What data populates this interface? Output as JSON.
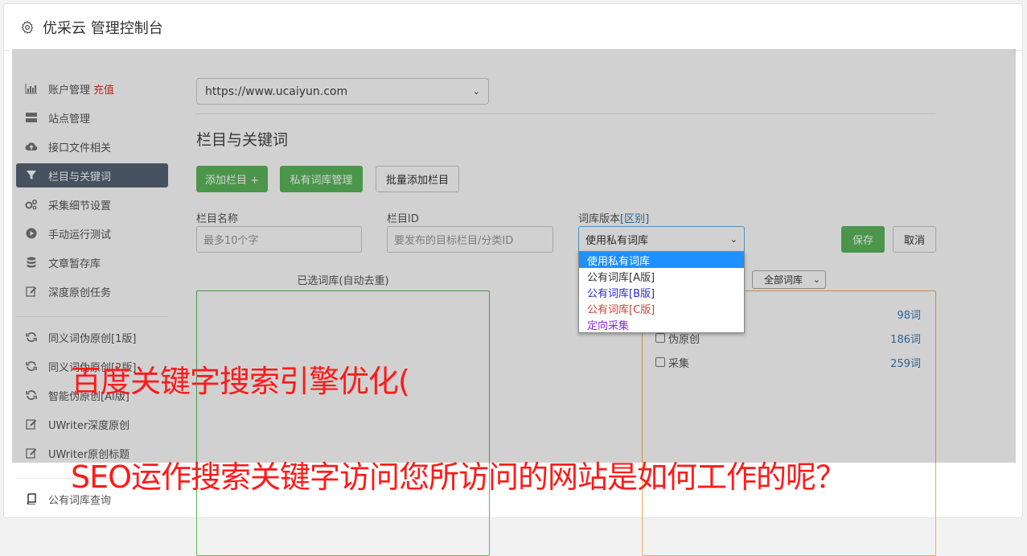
{
  "header": {
    "title": "优采云 管理控制台"
  },
  "sidebar": {
    "items": [
      {
        "label": "账户管理",
        "extra": "充值",
        "icon": "bar-chart-icon"
      },
      {
        "label": "站点管理",
        "icon": "server-icon"
      },
      {
        "label": "接口文件相关",
        "icon": "cloud-upload-icon"
      },
      {
        "label": "栏目与关键词",
        "icon": "filter-icon",
        "active": true
      },
      {
        "label": "采集细节设置",
        "icon": "gears-icon"
      },
      {
        "label": "手动运行测试",
        "icon": "play-circle-icon"
      },
      {
        "label": "文章暂存库",
        "icon": "database-icon"
      },
      {
        "label": "深度原创任务",
        "icon": "edit-icon"
      },
      {
        "label": "同义词伪原创[1版]",
        "icon": "refresh-icon"
      },
      {
        "label": "同义词伪原创[2版]",
        "icon": "refresh-icon"
      },
      {
        "label": "智能伪原创[AI版]",
        "icon": "refresh-icon"
      },
      {
        "label": "UWriter深度原创",
        "icon": "edit-icon"
      },
      {
        "label": "UWriter原创标题",
        "icon": "edit-icon"
      },
      {
        "label": "公有词库查询",
        "icon": "book-icon"
      }
    ]
  },
  "main": {
    "site_url": "https://www.ucaiyun.com",
    "section_title": "栏目与关键词",
    "buttons": {
      "add_column": "添加栏目 +",
      "private_lib": "私有词库管理",
      "batch_add": "批量添加栏目",
      "save": "保存",
      "cancel": "取消"
    },
    "fields": {
      "column_name_label": "栏目名称",
      "column_name_placeholder": "最多10个字",
      "column_id_label": "栏目ID",
      "column_id_placeholder": "要发布的目标栏目/分类ID",
      "lib_version_label": "词库版本",
      "lib_version_link": "[区别]",
      "lib_version_value": "使用私有词库"
    },
    "dropdown_options": [
      {
        "label": "使用私有词库",
        "color": "#ffffff"
      },
      {
        "label": "公有词库[A版]",
        "color": "#333333"
      },
      {
        "label": "公有词库[B版]",
        "color": "#2a2ad6"
      },
      {
        "label": "公有词库[C版]",
        "color": "#d43f3a"
      },
      {
        "label": "定向采集",
        "color": "#8a2be2"
      }
    ],
    "selected_box_title": "已选词库(自动去重)",
    "lib_filter": "全部词库",
    "lib_rows": [
      {
        "label": "",
        "count": "98词"
      },
      {
        "label": "伪原创",
        "count": "186词"
      },
      {
        "label": "采集",
        "count": "259词"
      }
    ]
  },
  "watermark": {
    "line1": "百度关键字搜索引擎优化(",
    "line2": "SEO运作搜索关键字访问您所访问的网站是如何工作的呢？"
  },
  "colors": {
    "accent_green": "#5cb85c",
    "active_nav": "#566474",
    "watermark": "#ff1a1a"
  }
}
